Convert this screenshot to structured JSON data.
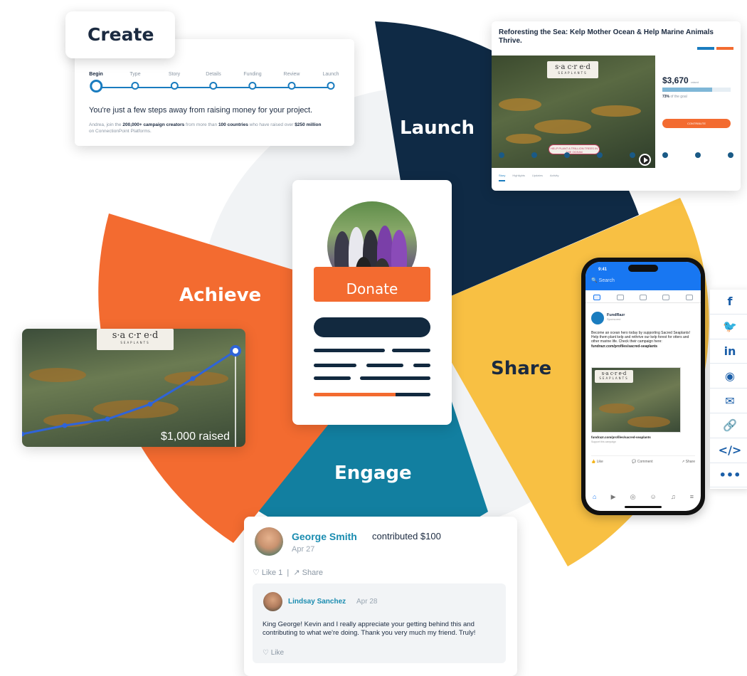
{
  "segments": {
    "create": "Create",
    "launch": "Launch",
    "share": "Share",
    "engage": "Engage",
    "achieve": "Achieve"
  },
  "colors": {
    "navy": "#0f2a45",
    "orange": "#f36b30",
    "yellow": "#f8c043",
    "teal": "#127fa0",
    "light_gray": "#f1f3f5"
  },
  "create_card": {
    "steps": [
      "Begin",
      "Type",
      "Story",
      "Details",
      "Funding",
      "Review",
      "Launch"
    ],
    "headline": "You're just a few steps away from raising money for your project.",
    "body_prefix": "Andrea, join the ",
    "body_b1": "200,000+ campaign creators",
    "body_mid": " from more than ",
    "body_b2": "100 countries",
    "body_mid2": " who have raised over ",
    "body_b3": "$250 million",
    "body_suffix": " on ConnectionPoint Platforms."
  },
  "launch_card": {
    "title": "Reforesting the Sea: Kelp Mother Ocean & Help Marine Animals Thrive.",
    "amount": "$3,670",
    "amount_sub": "raised",
    "progress": 0.73,
    "pct": "73%",
    "pct_sub": "of the goal",
    "donate": "CONTRIBUTE",
    "tabs": [
      "Story",
      "Highlights",
      "Updates",
      "Activity"
    ],
    "pill": "HELP PLANT A TRILLION TREES IN THE OCEAN"
  },
  "logo": {
    "main": "s·a c·r e·d",
    "sub": "SEAPLANTS"
  },
  "center_card": {
    "donate": "Donate",
    "progress": 0.7
  },
  "achieve_card": {
    "raised": "$1,000 raised",
    "growth": [
      0.08,
      0.16,
      0.22,
      0.36,
      0.6,
      0.86
    ]
  },
  "phone": {
    "time": "9:41",
    "search": "Search",
    "page_name": "FundRazr",
    "sponsored": "Sponsored",
    "post_text": "Become an ocean hero today by supporting Sacred Seaplants! Help them plant kelp and rethrive our kelp forest for otters and other marine life. Check their campaign here:",
    "post_link": "fundrazr.com/profiles/sacred-seaplants",
    "caption": "fundrazr.com/profiles/sacred-seaplants",
    "caption_sub": "Support this campaign",
    "like": "Like",
    "comment": "Comment",
    "share": "Share"
  },
  "share_panel": {
    "icons": [
      "f",
      "🐦",
      "in",
      "◉",
      "✉",
      "🔗",
      "</>",
      "•••"
    ]
  },
  "engage_card": {
    "name": "George Smith",
    "contrib": "contributed $100",
    "date": "Apr 27",
    "like": "Like",
    "like_count": "1",
    "share": "Share",
    "reply_name": "Lindsay Sanchez",
    "reply_date": "Apr 28",
    "reply_text": "King George! Kevin and I really appreciate your getting behind this and contributing to what we're doing. Thank you very much my friend. Truly!",
    "reply_like": "Like"
  }
}
